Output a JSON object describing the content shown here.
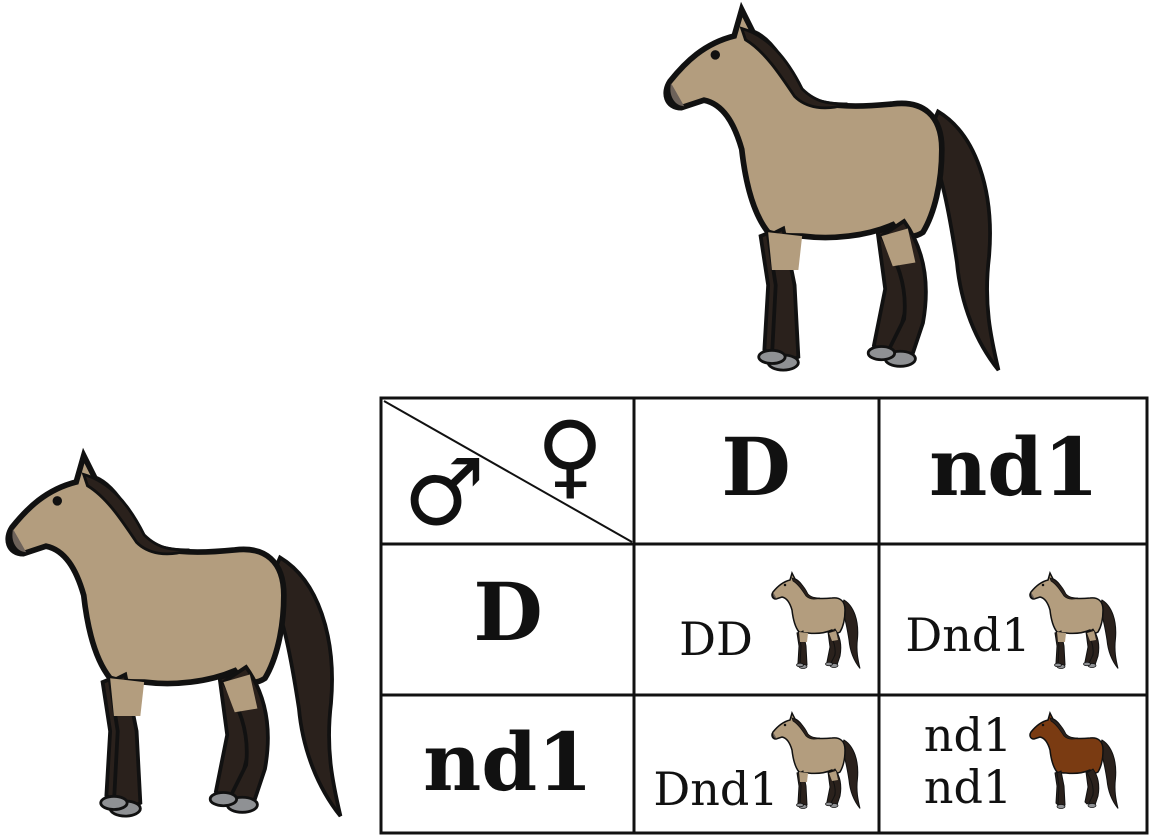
{
  "symbols": {
    "female": "♀",
    "male": "♂"
  },
  "columns": [
    "D",
    "nd1"
  ],
  "rows": [
    "D",
    "nd1"
  ],
  "cells": [
    {
      "genotype_lines": [
        "DD"
      ],
      "foal_color": "dun"
    },
    {
      "genotype_lines": [
        "Dnd1"
      ],
      "foal_color": "dun"
    },
    {
      "genotype_lines": [
        "Dnd1"
      ],
      "foal_color": "dun"
    },
    {
      "genotype_lines": [
        "nd1",
        "nd1"
      ],
      "foal_color": "bay"
    }
  ],
  "colors": {
    "dun_body": "#b39d7e",
    "bay_body": "#7a3b12",
    "points": "#2a211c",
    "hoof": "#8f9194",
    "outline": "#111111"
  }
}
